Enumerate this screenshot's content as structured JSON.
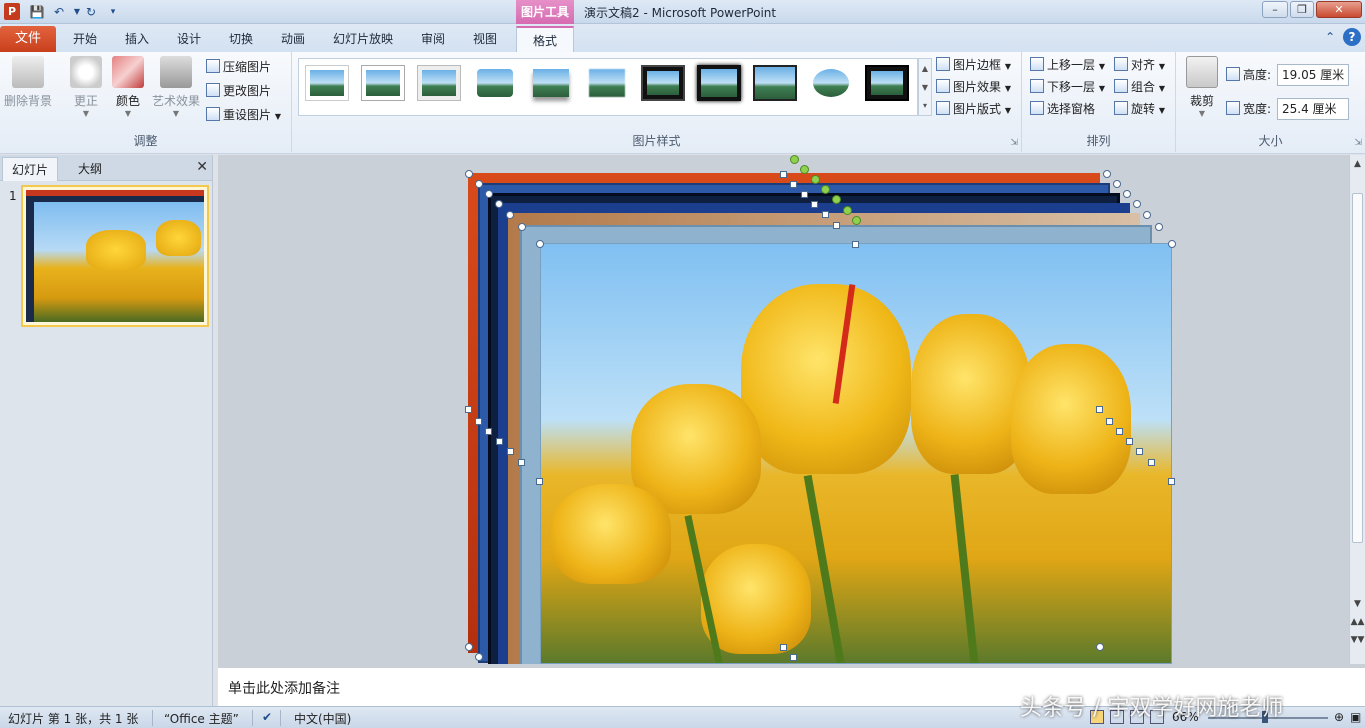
{
  "window": {
    "title": "演示文稿2  -  Microsoft PowerPoint",
    "context_tab_group": "图片工具",
    "app_icon_letter": "P"
  },
  "tabs": {
    "file": "文件",
    "items": [
      "开始",
      "插入",
      "设计",
      "切换",
      "动画",
      "幻灯片放映",
      "审阅",
      "视图",
      "格式"
    ],
    "active": "格式"
  },
  "ribbon": {
    "adjust": {
      "label": "调整",
      "remove_background": "删除背景",
      "corrections": "更正",
      "color": "颜色",
      "artistic_effects": "艺术效果",
      "compress": "压缩图片",
      "change_picture": "更改图片",
      "reset_picture": "重设图片"
    },
    "styles": {
      "label": "图片样式",
      "border": "图片边框",
      "effects": "图片效果",
      "layout": "图片版式"
    },
    "arrange": {
      "label": "排列",
      "bring_forward": "上移一层",
      "send_backward": "下移一层",
      "selection_pane": "选择窗格",
      "align": "对齐",
      "group": "组合",
      "rotate": "旋转"
    },
    "size": {
      "label": "大小",
      "crop": "裁剪",
      "height_label": "高度:",
      "height_value": "19.05 厘米",
      "width_label": "宽度:",
      "width_value": "25.4 厘米"
    }
  },
  "left_panel": {
    "tab_slides": "幻灯片",
    "tab_outline": "大纲",
    "slide_number": "1"
  },
  "notes": {
    "placeholder": "单击此处添加备注"
  },
  "status": {
    "slide_info": "幻灯片 第 1 张，共 1 张",
    "theme": "“Office 主题”",
    "language": "中文(中国)",
    "zoom": "66%"
  },
  "watermark": "头条号 / 宇双学好网施老师",
  "colors": {
    "file_tab": "#c8401b",
    "context_pink": "#d66cb1",
    "accent_blue": "#2e6fc6"
  }
}
